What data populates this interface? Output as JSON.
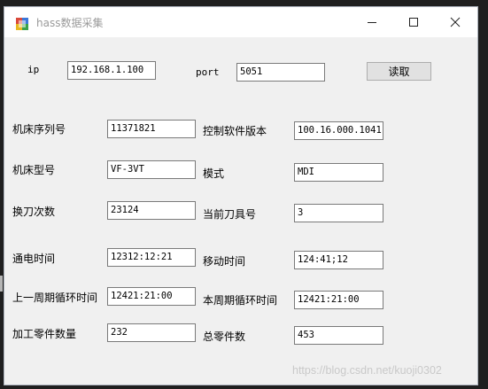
{
  "window": {
    "title": "hass数据采集",
    "controls": {
      "minimize": "minimize-icon",
      "maximize": "maximize-icon",
      "close": "close-icon"
    }
  },
  "connection": {
    "ip_label": "ip",
    "ip_value": "192.168.1.100",
    "port_label": "port",
    "port_value": "5051",
    "read_button": "读取"
  },
  "fields": [
    {
      "label": "机床序列号",
      "value": "11371821"
    },
    {
      "label": "控制软件版本",
      "value": "100.16.000.1041"
    },
    {
      "label": "机床型号",
      "value": "VF-3VT"
    },
    {
      "label": "模式",
      "value": "MDI"
    },
    {
      "label": "换刀次数",
      "value": "23124"
    },
    {
      "label": "当前刀具号",
      "value": "3"
    },
    {
      "label": "通电时间",
      "value": "12312:12:21"
    },
    {
      "label": "移动时间",
      "value": "124:41;12"
    },
    {
      "label": "上一周期循环时间",
      "value": "12421:21:00"
    },
    {
      "label": "本周期循环时间",
      "value": "12421:21:00"
    },
    {
      "label": "加工零件数量",
      "value": "232"
    },
    {
      "label": "总零件数",
      "value": "453"
    }
  ],
  "watermark": "https://blog.csdn.net/kuoji0302",
  "colors": {
    "window_bg": "#f0f0f0",
    "titlebar_bg": "#ffffff",
    "outer_bg": "#1f1f1f"
  }
}
